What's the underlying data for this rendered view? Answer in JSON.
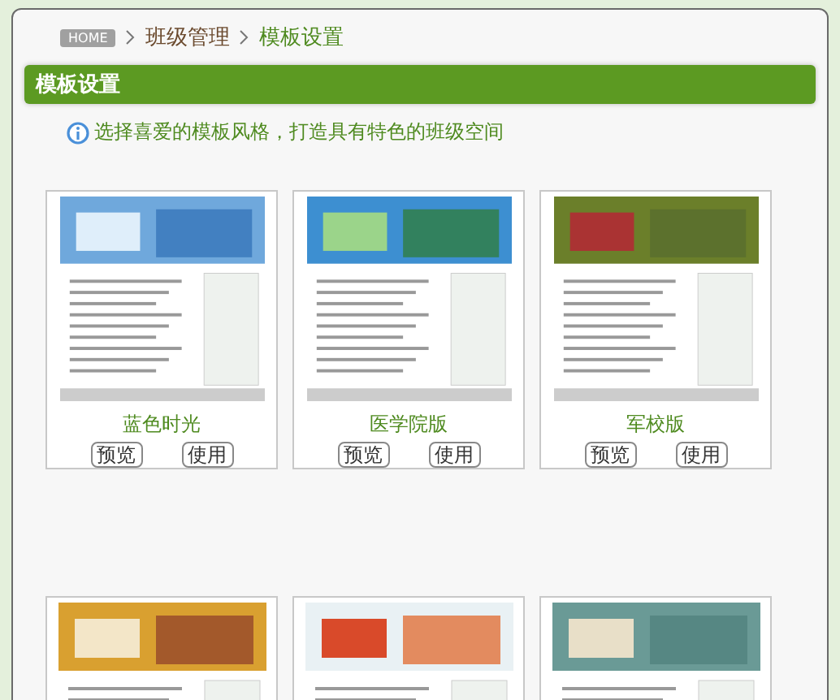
{
  "breadcrumb": {
    "home": "HOME",
    "items": [
      "班级管理",
      "模板设置"
    ]
  },
  "section_title": "模板设置",
  "hint": "选择喜爱的模板风格，打造具有特色的班级空间",
  "templates": [
    {
      "name": "蓝色时光",
      "kind": "blue",
      "buttons": [
        "预览",
        "使用"
      ]
    },
    {
      "name": "医学院版",
      "kind": "medical",
      "buttons": [
        "预览",
        "使用"
      ]
    },
    {
      "name": "军校版",
      "kind": "military",
      "buttons": [
        "预览",
        "使用"
      ]
    },
    {
      "kind": "orange"
    },
    {
      "kind": "red"
    },
    {
      "kind": "teal"
    }
  ]
}
